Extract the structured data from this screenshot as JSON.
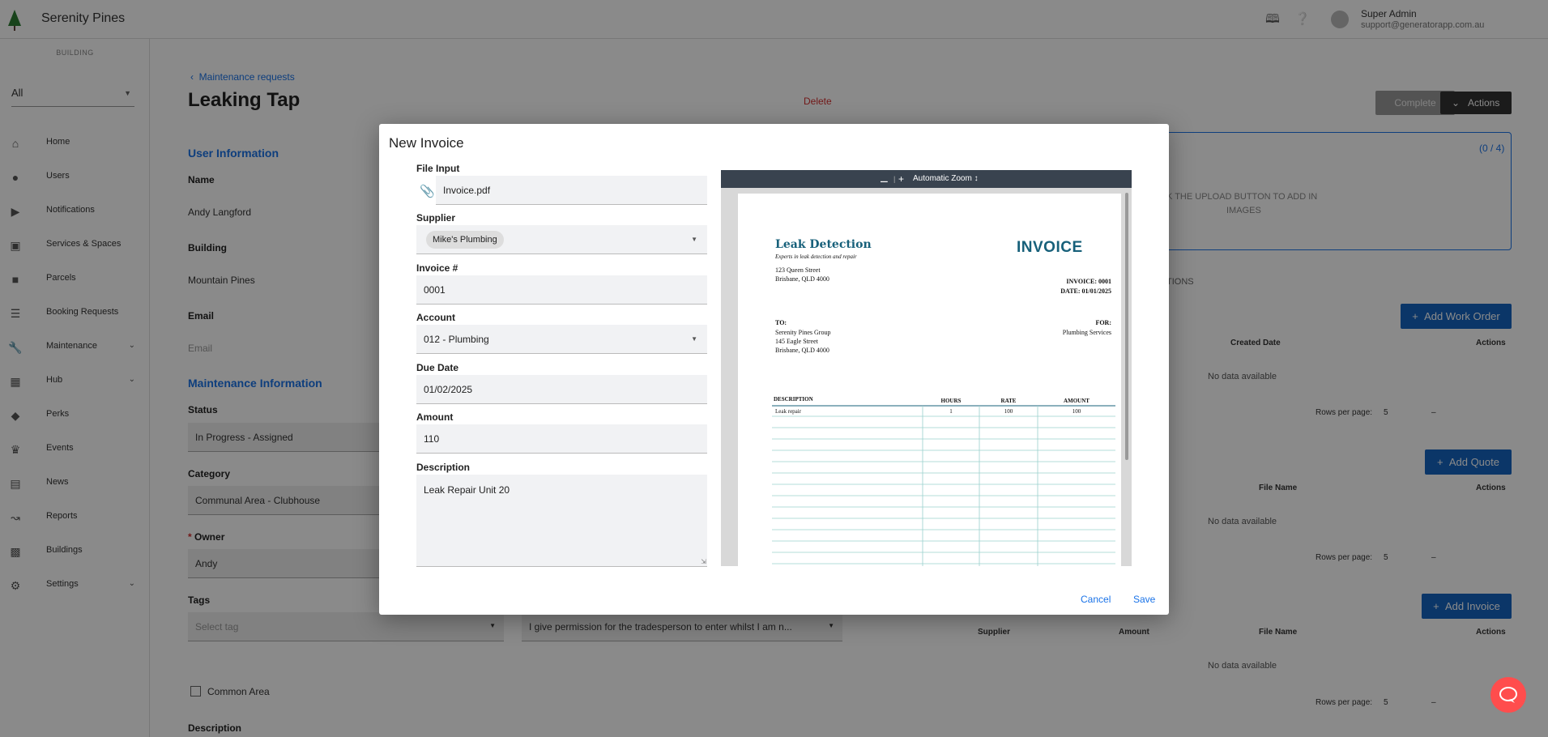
{
  "app": {
    "title": "Serenity Pines",
    "user_name": "Super Admin",
    "user_email": "support@generatorapp.com.au"
  },
  "sidebar": {
    "building_label": "BUILDING",
    "building_value": "All",
    "items": [
      {
        "label": "Home",
        "icon": "home-icon"
      },
      {
        "label": "Users",
        "icon": "user-icon"
      },
      {
        "label": "Notifications",
        "icon": "megaphone-icon"
      },
      {
        "label": "Services & Spaces",
        "icon": "store-icon"
      },
      {
        "label": "Parcels",
        "icon": "parcel-icon"
      },
      {
        "label": "Booking Requests",
        "icon": "booking-icon"
      },
      {
        "label": "Maintenance",
        "icon": "wrench-icon",
        "expandable": true
      },
      {
        "label": "Hub",
        "icon": "grid-icon",
        "expandable": true
      },
      {
        "label": "Perks",
        "icon": "tag-icon"
      },
      {
        "label": "Events",
        "icon": "crown-icon"
      },
      {
        "label": "News",
        "icon": "news-icon"
      },
      {
        "label": "Reports",
        "icon": "chart-icon"
      },
      {
        "label": "Buildings",
        "icon": "building-icon"
      },
      {
        "label": "Settings",
        "icon": "gear-icon",
        "expandable": true
      }
    ]
  },
  "page": {
    "breadcrumb": "Maintenance requests",
    "title": "Leaking Tap",
    "delete_label": "Delete",
    "complete_label": "Complete",
    "actions_label": "Actions",
    "user_info_title": "User Information",
    "name_label": "Name",
    "name_value": "Andy Langford",
    "building_label": "Building",
    "building_value": "Mountain Pines",
    "email_label": "Email",
    "email_placeholder": "Email",
    "maint_info_title": "Maintenance Information",
    "status_label": "Status",
    "status_value": "In Progress - Assigned",
    "category_label": "Category",
    "category_value": "Communal Area - Clubhouse",
    "owner_label": "Owner",
    "owner_value": "Andy",
    "tags_label": "Tags",
    "tags_placeholder": "Select tag",
    "permission_value": "I give permission for the tradesperson to enter whilst I am n...",
    "common_area_label": "Common Area",
    "description_label": "Description",
    "images_count": "(0 / 4)",
    "images_hint_1": "K THE UPLOAD BUTTON TO ADD IN",
    "images_hint_2": "IMAGES",
    "tab_partial": "TIONS",
    "add_work_order": "Add Work Order",
    "add_quote": "Add Quote",
    "add_invoice": "Add Invoice",
    "wo_headers": [
      "Created Date",
      "Actions"
    ],
    "quote_headers": [
      "File Name",
      "Actions"
    ],
    "invoice_headers": [
      "Supplier",
      "Amount",
      "File Name",
      "Actions"
    ],
    "no_data": "No data available",
    "rows_per_page_label": "Rows per page:",
    "rows_per_page_value": "5",
    "pager_range": "–"
  },
  "modal": {
    "title": "New Invoice",
    "file_input_label": "File Input",
    "file_value": "Invoice.pdf",
    "supplier_label": "Supplier",
    "supplier_value": "Mike's Plumbing",
    "invoice_no_label": "Invoice #",
    "invoice_no_value": "0001",
    "account_label": "Account",
    "account_value": "012 - Plumbing",
    "due_date_label": "Due Date",
    "due_date_value": "01/02/2025",
    "amount_label": "Amount",
    "amount_value": "110",
    "description_label": "Description",
    "description_value": "Leak Repair Unit 20",
    "cancel_label": "Cancel",
    "save_label": "Save"
  },
  "pdf": {
    "zoom_label": "Automatic Zoom",
    "company": "Leak Detection",
    "tagline": "Experts in leak detection and repair",
    "company_addr1": "123 Queen Street",
    "company_addr2": "Brisbane, QLD 4000",
    "doc_title": "INVOICE",
    "invoice_line": "INVOICE: 0001",
    "date_line": "DATE: 01/01/2025",
    "to_label": "TO:",
    "to_1": "Serenity Pines Group",
    "to_2": "145 Eagle Street",
    "to_3": "Brisbane, QLD 4000",
    "for_label": "FOR:",
    "for_value": "Plumbing Services",
    "col_description": "DESCRIPTION",
    "col_hours": "HOURS",
    "col_rate": "RATE",
    "col_amount": "AMOUNT",
    "row_desc": "Leak repair",
    "row_hours": "1",
    "row_rate": "100",
    "row_amount": "100"
  }
}
